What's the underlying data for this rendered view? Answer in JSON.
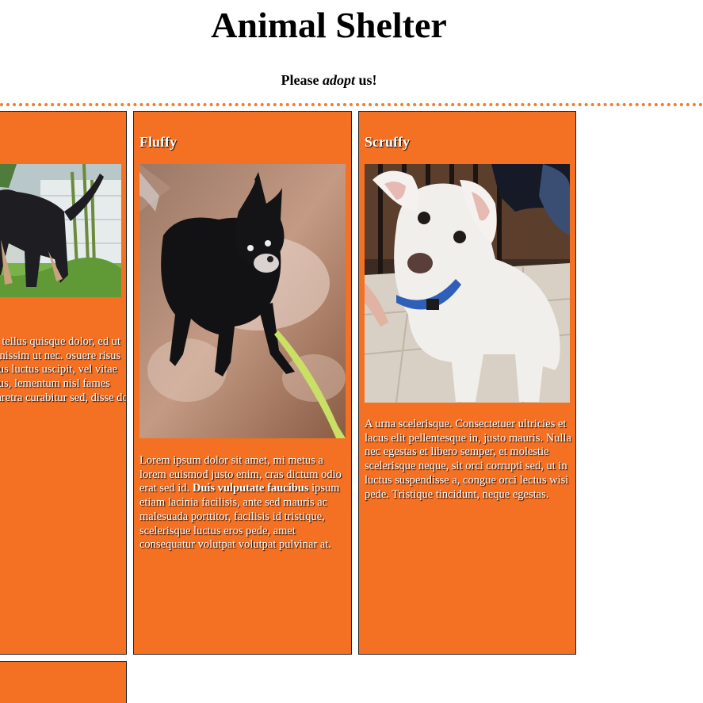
{
  "header": {
    "title": "Animal Shelter",
    "subtitle_pre": "Please ",
    "subtitle_em": "adopt",
    "subtitle_post": " us!"
  },
  "pets": [
    {
      "name": "",
      "description": "uat tellus quisque dolor, ed ut dignissim ut nec. osuere risus lacus luctus uscipit, vel vitae lacus, lementum nisl fames pharetra curabitur sed, disse dolor eu."
    },
    {
      "name": "Fluffy",
      "description_pre": "Lorem ipsum dolor sit amet, mi metus a lorem euismod justo enim, cras dictum odio erat sed id. ",
      "description_bold": "Duis vulputate faucibus",
      "description_post": " ipsum etiam lacinia facilisis, ante sed mauris ac malesuada porttitor, facilisis id tristique, scelerisque luctus eros pede, amet consequatur volutpat volutpat pulvinar at."
    },
    {
      "name": "Scruffy",
      "description": "A urna scelerisque. Consectetuer ultricies et lacus elit pellentesque in, justo mauris. Nulla nec egestas et libero semper, et molestie scelerisque neque, sit orci corrupti sed, ut in luctus suspendisse a, congue orci lectus wisi pede. Tristique tincidunt, neque egestas."
    }
  ],
  "colors": {
    "card_background": "#f47023",
    "divider": "#f47b2a"
  }
}
